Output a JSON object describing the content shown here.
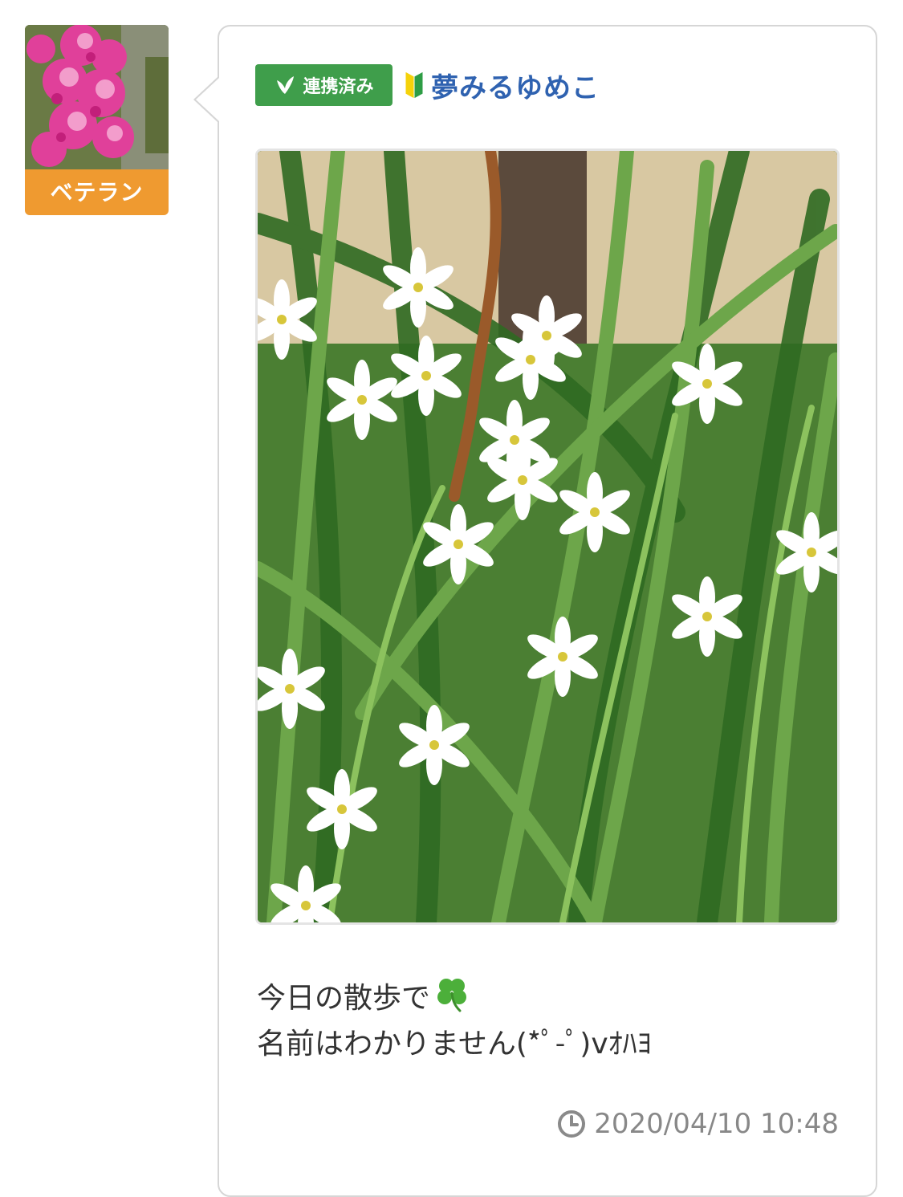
{
  "author": {
    "rank_badge": "ベテラン",
    "avatar_icon": "pink-peony-photo",
    "name": "夢みるゆめこ",
    "name_color": "#2f62b0",
    "beginner_icon": "beginner-mark-icon"
  },
  "linked_badge": {
    "label": "連携済み",
    "icon": "leaf-icon",
    "color": "#3f9e4b"
  },
  "post": {
    "photo_icon": "white-star-flowers-photo",
    "body_line1": "今日の散歩で",
    "body_emoji": "clover-icon",
    "body_line2": "名前はわかりません(*ﾟ-ﾟ)vｵﾊﾖ",
    "timestamp": "2020/04/10 10:48",
    "timestamp_icon": "clock-icon"
  },
  "colors": {
    "rank_badge": "#ef9a30",
    "card_border": "#d6d6d6",
    "text": "#333333",
    "muted": "#888888"
  }
}
